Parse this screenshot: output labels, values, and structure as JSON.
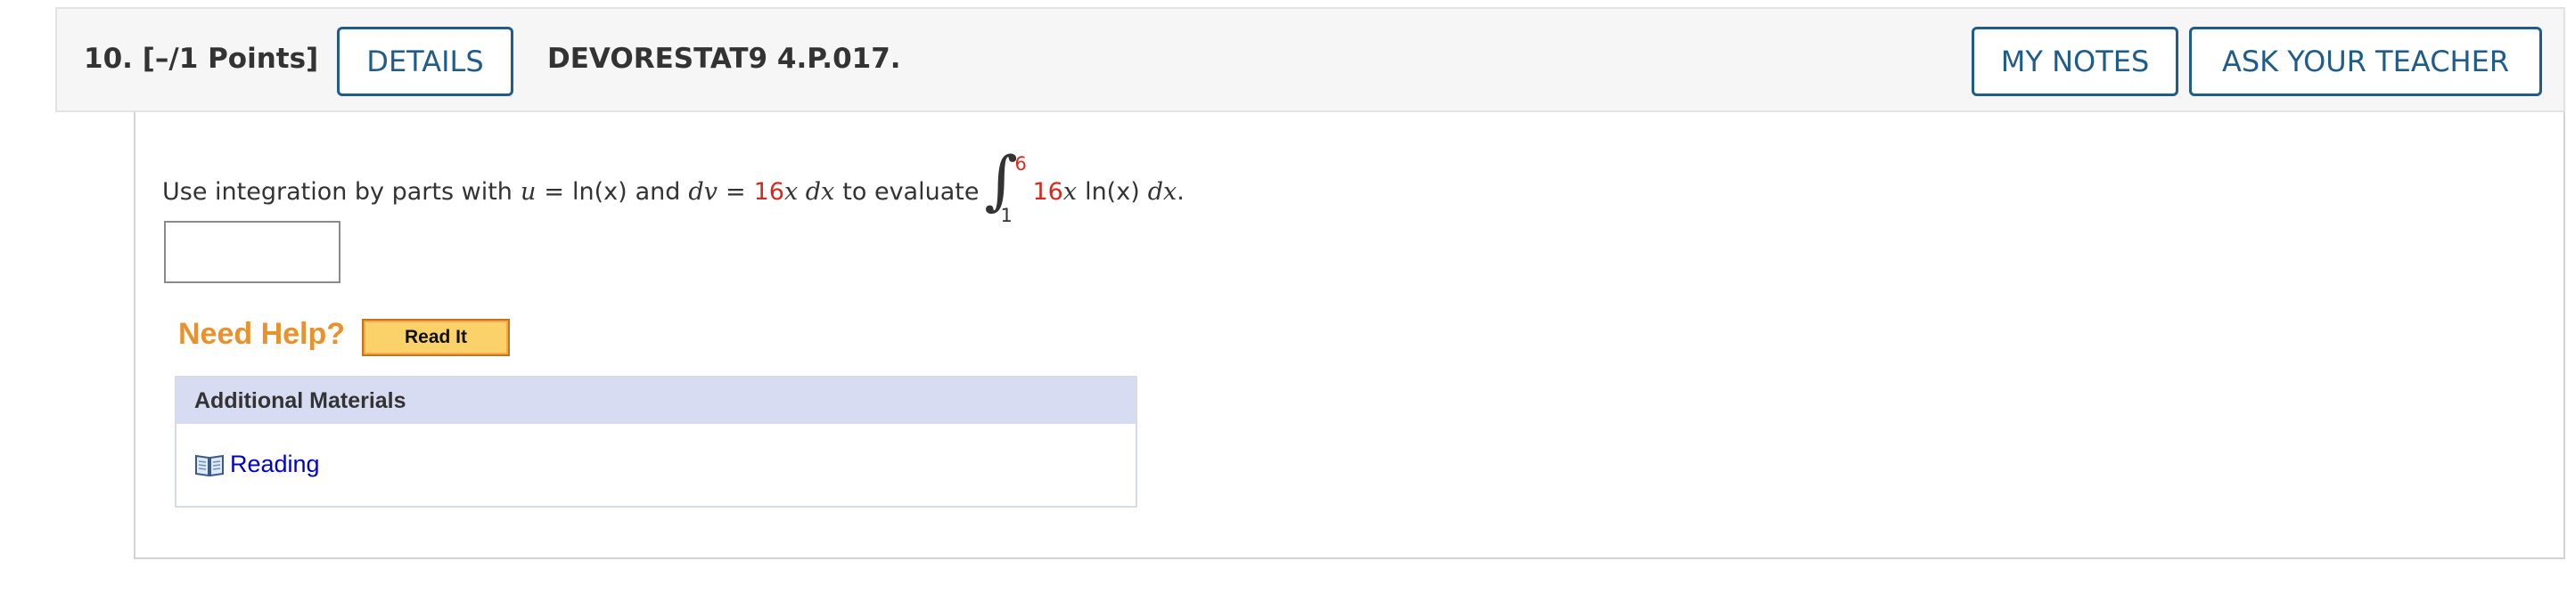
{
  "header": {
    "question_number": "10.",
    "points": "[–/1 Points]",
    "details_label": "DETAILS",
    "question_code": "DEVORESTAT9 4.P.017.",
    "my_notes_label": "MY NOTES",
    "ask_teacher_label": "ASK YOUR TEACHER"
  },
  "prompt": {
    "lead": "Use integration by parts with",
    "u_var": "u",
    "eq1": "=",
    "u_expr": "ln(x)",
    "and": "and",
    "dv_var": "dv",
    "eq2": "=",
    "dv_coef": "16",
    "dv_rest": "x dx",
    "to_evaluate": "to evaluate",
    "integral_upper": "6",
    "integral_lower": "1",
    "integrand_coef": "16",
    "integrand_x": "x",
    "integrand_ln": "ln(x)",
    "integrand_dx": "dx",
    "period": "."
  },
  "answer": {
    "value": "",
    "placeholder": ""
  },
  "help": {
    "need_help_label": "Need Help?",
    "read_it_label": "Read It"
  },
  "materials": {
    "header": "Additional Materials",
    "items": [
      {
        "label": "Reading",
        "icon": "book-icon"
      }
    ]
  },
  "colors": {
    "accent_blue": "#1f5c8a",
    "highlight_red": "#d62a1e",
    "help_orange": "#e8922e",
    "link_blue": "#0000cc",
    "materials_header_bg": "#d7dcf2"
  }
}
